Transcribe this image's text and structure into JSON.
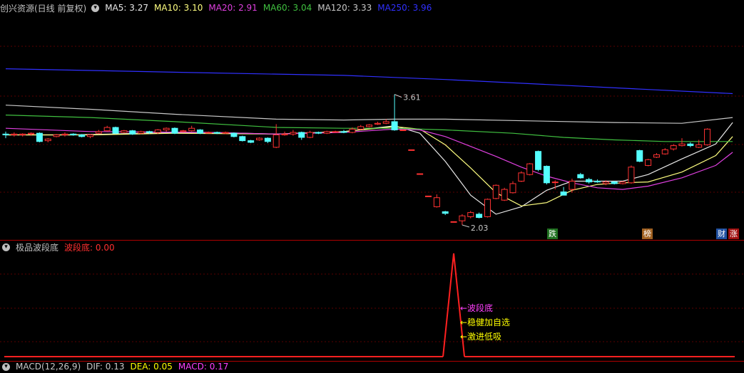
{
  "main_legend": {
    "title": "创兴资源(日线 前复权)",
    "items": [
      {
        "label": "MA5: 3.27",
        "color": "#e8e8e8"
      },
      {
        "label": "MA10: 3.10",
        "color": "#ffff80"
      },
      {
        "label": "MA20: 2.91",
        "color": "#e040e0"
      },
      {
        "label": "MA60: 3.04",
        "color": "#40c040"
      },
      {
        "label": "MA120: 3.33",
        "color": "#c8c8c8"
      },
      {
        "label": "MA250: 3.96",
        "color": "#3030ff"
      }
    ]
  },
  "annotations": {
    "high": "3.61",
    "low": "2.03"
  },
  "badges": [
    {
      "text": "跌",
      "bg": "#207020"
    },
    {
      "text": "榜",
      "bg": "#a06020"
    },
    {
      "text": "财",
      "bg": "#2050a0"
    },
    {
      "text": "涨",
      "bg": "#a01010"
    }
  ],
  "indicator_legend": {
    "title": "极品波段底",
    "items": [
      {
        "label": "波段底: 0.00",
        "color": "#ff3030"
      }
    ]
  },
  "signal_labels": [
    {
      "text": "←波段底",
      "color": "#ff40ff"
    },
    {
      "text": "←稳健加自选",
      "color": "#ffff00"
    },
    {
      "text": "←激进低吸",
      "color": "#ffff00"
    }
  ],
  "macd_legend": {
    "items": [
      {
        "label": "MACD(12,26,9)",
        "color": "#c8c8c8"
      },
      {
        "label": "DIF: 0.13",
        "color": "#c8c8c8"
      },
      {
        "label": "DEA: 0.05",
        "color": "#ffff00"
      },
      {
        "label": "MACD: 0.17",
        "color": "#ff40ff"
      }
    ]
  },
  "icons": {
    "collapse_icon": "chevron-down-icon"
  },
  "colors": {
    "up": "#ff3232",
    "down": "#54ffff",
    "frame": "#b00000"
  },
  "chart_data": {
    "type": "candlestick",
    "title": "创兴资源(日线 前复权)",
    "y_price_marks": {
      "high": 3.61,
      "low": 2.03
    },
    "candles": [
      {
        "o": 3.13,
        "c": 3.12,
        "h": 3.16,
        "l": 3.08
      },
      {
        "o": 3.12,
        "c": 3.13,
        "h": 3.15,
        "l": 3.1
      },
      {
        "o": 3.12,
        "c": 3.13,
        "h": 3.14,
        "l": 3.1
      },
      {
        "o": 3.13,
        "c": 3.14,
        "h": 3.15,
        "l": 3.11
      },
      {
        "o": 3.14,
        "c": 3.04,
        "h": 3.15,
        "l": 3.03
      },
      {
        "o": 3.05,
        "c": 3.07,
        "h": 3.08,
        "l": 3.03
      },
      {
        "o": 3.1,
        "c": 3.12,
        "h": 3.13,
        "l": 3.09
      },
      {
        "o": 3.12,
        "c": 3.13,
        "h": 3.15,
        "l": 3.1
      },
      {
        "o": 3.13,
        "c": 3.12,
        "h": 3.14,
        "l": 3.11
      },
      {
        "o": 3.12,
        "c": 3.1,
        "h": 3.13,
        "l": 3.09
      },
      {
        "o": 3.1,
        "c": 3.12,
        "h": 3.13,
        "l": 3.08
      },
      {
        "o": 3.14,
        "c": 3.16,
        "h": 3.18,
        "l": 3.13
      },
      {
        "o": 3.17,
        "c": 3.21,
        "h": 3.23,
        "l": 3.16
      },
      {
        "o": 3.21,
        "c": 3.14,
        "h": 3.22,
        "l": 3.13
      },
      {
        "o": 3.15,
        "c": 3.17,
        "h": 3.18,
        "l": 3.14
      },
      {
        "o": 3.17,
        "c": 3.13,
        "h": 3.18,
        "l": 3.12
      },
      {
        "o": 3.14,
        "c": 3.16,
        "h": 3.17,
        "l": 3.13
      },
      {
        "o": 3.16,
        "c": 3.15,
        "h": 3.17,
        "l": 3.13
      },
      {
        "o": 3.15,
        "c": 3.18,
        "h": 3.19,
        "l": 3.13
      },
      {
        "o": 3.18,
        "c": 3.2,
        "h": 3.21,
        "l": 3.16
      },
      {
        "o": 3.2,
        "c": 3.14,
        "h": 3.21,
        "l": 3.13
      },
      {
        "o": 3.16,
        "c": 3.17,
        "h": 3.18,
        "l": 3.15
      },
      {
        "o": 3.17,
        "c": 3.2,
        "h": 3.23,
        "l": 3.16
      },
      {
        "o": 3.18,
        "c": 3.14,
        "h": 3.19,
        "l": 3.13
      },
      {
        "o": 3.15,
        "c": 3.15,
        "h": 3.16,
        "l": 3.14
      },
      {
        "o": 3.15,
        "c": 3.14,
        "h": 3.16,
        "l": 3.13
      },
      {
        "o": 3.14,
        "c": 3.15,
        "h": 3.16,
        "l": 3.13
      },
      {
        "o": 3.14,
        "c": 3.1,
        "h": 3.15,
        "l": 3.09
      },
      {
        "o": 3.1,
        "c": 3.05,
        "h": 3.11,
        "l": 3.04
      },
      {
        "o": 3.05,
        "c": 3.03,
        "h": 3.06,
        "l": 3.02
      },
      {
        "o": 3.06,
        "c": 3.08,
        "h": 3.09,
        "l": 3.05
      },
      {
        "o": 3.08,
        "c": 3.04,
        "h": 3.09,
        "l": 3.02
      },
      {
        "o": 2.97,
        "c": 3.12,
        "h": 3.25,
        "l": 2.96
      },
      {
        "o": 3.12,
        "c": 3.13,
        "h": 3.16,
        "l": 3.11
      },
      {
        "o": 3.13,
        "c": 3.15,
        "h": 3.18,
        "l": 3.11
      },
      {
        "o": 3.15,
        "c": 3.09,
        "h": 3.16,
        "l": 3.06
      },
      {
        "o": 3.09,
        "c": 3.15,
        "h": 3.17,
        "l": 3.08
      },
      {
        "o": 3.15,
        "c": 3.14,
        "h": 3.16,
        "l": 3.13
      },
      {
        "o": 3.14,
        "c": 3.16,
        "h": 3.17,
        "l": 3.13
      },
      {
        "o": 3.16,
        "c": 3.16,
        "h": 3.17,
        "l": 3.15
      },
      {
        "o": 3.16,
        "c": 3.15,
        "h": 3.18,
        "l": 3.14
      },
      {
        "o": 3.15,
        "c": 3.19,
        "h": 3.21,
        "l": 3.14
      },
      {
        "o": 3.19,
        "c": 3.22,
        "h": 3.24,
        "l": 3.18
      },
      {
        "o": 3.22,
        "c": 3.24,
        "h": 3.25,
        "l": 3.21
      },
      {
        "o": 3.25,
        "c": 3.26,
        "h": 3.28,
        "l": 3.24
      },
      {
        "o": 3.26,
        "c": 3.28,
        "h": 3.31,
        "l": 3.25
      },
      {
        "o": 3.28,
        "c": 3.18,
        "h": 3.61,
        "l": 3.17
      },
      {
        "o": 3.18,
        "c": 3.18,
        "h": 3.18,
        "l": 3.18
      },
      {
        "o": 2.94,
        "c": 2.94,
        "h": 2.94,
        "l": 2.94
      },
      {
        "o": 2.65,
        "c": 2.65,
        "h": 2.65,
        "l": 2.65
      },
      {
        "o": 2.38,
        "c": 2.38,
        "h": 2.38,
        "l": 2.38
      },
      {
        "o": 2.25,
        "c": 2.36,
        "h": 2.4,
        "l": 2.24
      },
      {
        "o": 2.19,
        "c": 2.17,
        "h": 2.2,
        "l": 2.15
      },
      {
        "o": 2.07,
        "c": 2.07,
        "h": 2.07,
        "l": 2.07
      },
      {
        "o": 2.08,
        "c": 2.14,
        "h": 2.16,
        "l": 2.03
      },
      {
        "o": 2.13,
        "c": 2.18,
        "h": 2.2,
        "l": 2.11
      },
      {
        "o": 2.16,
        "c": 2.12,
        "h": 2.18,
        "l": 2.11
      },
      {
        "o": 2.13,
        "c": 2.34,
        "h": 2.35,
        "l": 2.12
      },
      {
        "o": 2.35,
        "c": 2.51,
        "h": 2.52,
        "l": 2.34
      },
      {
        "o": 2.33,
        "c": 2.46,
        "h": 2.48,
        "l": 2.32
      },
      {
        "o": 2.42,
        "c": 2.53,
        "h": 2.56,
        "l": 2.41
      },
      {
        "o": 2.56,
        "c": 2.66,
        "h": 2.68,
        "l": 2.55
      },
      {
        "o": 2.64,
        "c": 2.77,
        "h": 2.78,
        "l": 2.63
      },
      {
        "o": 2.92,
        "c": 2.7,
        "h": 2.93,
        "l": 2.68
      },
      {
        "o": 2.74,
        "c": 2.54,
        "h": 2.75,
        "l": 2.52
      },
      {
        "o": 2.55,
        "c": 2.55,
        "h": 2.57,
        "l": 2.46
      },
      {
        "o": 2.43,
        "c": 2.39,
        "h": 2.49,
        "l": 2.39
      },
      {
        "o": 2.46,
        "c": 2.56,
        "h": 2.59,
        "l": 2.42
      },
      {
        "o": 2.64,
        "c": 2.6,
        "h": 2.66,
        "l": 2.59
      },
      {
        "o": 2.58,
        "c": 2.55,
        "h": 2.6,
        "l": 2.53
      },
      {
        "o": 2.56,
        "c": 2.55,
        "h": 2.58,
        "l": 2.54
      },
      {
        "o": 2.53,
        "c": 2.55,
        "h": 2.57,
        "l": 2.51
      },
      {
        "o": 2.55,
        "c": 2.53,
        "h": 2.56,
        "l": 2.52
      },
      {
        "o": 2.53,
        "c": 2.55,
        "h": 2.56,
        "l": 2.52
      },
      {
        "o": 2.54,
        "c": 2.73,
        "h": 2.75,
        "l": 2.53
      },
      {
        "o": 2.93,
        "c": 2.8,
        "h": 2.94,
        "l": 2.79
      },
      {
        "o": 2.75,
        "c": 2.82,
        "h": 2.83,
        "l": 2.74
      },
      {
        "o": 2.85,
        "c": 2.88,
        "h": 2.9,
        "l": 2.84
      },
      {
        "o": 2.89,
        "c": 2.94,
        "h": 2.96,
        "l": 2.88
      },
      {
        "o": 2.95,
        "c": 2.99,
        "h": 3.01,
        "l": 2.93
      },
      {
        "o": 2.99,
        "c": 3.01,
        "h": 3.08,
        "l": 2.98
      },
      {
        "o": 3.01,
        "c": 2.99,
        "h": 3.03,
        "l": 2.97
      },
      {
        "o": 2.97,
        "c": 3.0,
        "h": 3.06,
        "l": 2.96
      },
      {
        "o": 3.0,
        "c": 3.19,
        "h": 3.2,
        "l": 2.99
      }
    ],
    "ma_series": [
      {
        "name": "MA5",
        "values": [
          [
            0,
            3.12
          ],
          [
            8,
            3.12
          ],
          [
            16,
            3.14
          ],
          [
            24,
            3.15
          ],
          [
            32,
            3.13
          ],
          [
            40,
            3.16
          ],
          [
            46,
            3.23
          ],
          [
            49,
            3.14
          ],
          [
            52,
            2.8
          ],
          [
            55,
            2.39
          ],
          [
            58,
            2.16
          ],
          [
            61,
            2.25
          ],
          [
            64,
            2.45
          ],
          [
            67,
            2.56
          ],
          [
            70,
            2.56
          ],
          [
            73,
            2.56
          ],
          [
            76,
            2.64
          ],
          [
            80,
            2.83
          ],
          [
            84,
            3.01
          ],
          [
            86,
            3.27
          ]
        ]
      },
      {
        "name": "MA10",
        "values": [
          [
            0,
            3.12
          ],
          [
            10,
            3.12
          ],
          [
            20,
            3.14
          ],
          [
            32,
            3.13
          ],
          [
            40,
            3.16
          ],
          [
            46,
            3.22
          ],
          [
            49,
            3.19
          ],
          [
            52,
            3.0
          ],
          [
            55,
            2.72
          ],
          [
            58,
            2.42
          ],
          [
            61,
            2.26
          ],
          [
            64,
            2.3
          ],
          [
            67,
            2.45
          ],
          [
            70,
            2.52
          ],
          [
            73,
            2.54
          ],
          [
            76,
            2.55
          ],
          [
            80,
            2.67
          ],
          [
            84,
            2.87
          ],
          [
            86,
            3.1
          ]
        ]
      },
      {
        "name": "MA20",
        "values": [
          [
            0,
            3.2
          ],
          [
            10,
            3.16
          ],
          [
            24,
            3.15
          ],
          [
            32,
            3.13
          ],
          [
            40,
            3.15
          ],
          [
            46,
            3.19
          ],
          [
            49,
            3.18
          ],
          [
            52,
            3.1
          ],
          [
            55,
            2.98
          ],
          [
            58,
            2.86
          ],
          [
            61,
            2.73
          ],
          [
            64,
            2.62
          ],
          [
            67,
            2.54
          ],
          [
            70,
            2.48
          ],
          [
            73,
            2.46
          ],
          [
            76,
            2.5
          ],
          [
            80,
            2.6
          ],
          [
            84,
            2.75
          ],
          [
            86,
            2.91
          ]
        ]
      },
      {
        "name": "MA60",
        "values": [
          [
            0,
            3.36
          ],
          [
            10,
            3.33
          ],
          [
            20,
            3.28
          ],
          [
            32,
            3.21
          ],
          [
            40,
            3.2
          ],
          [
            46,
            3.2
          ],
          [
            52,
            3.18
          ],
          [
            60,
            3.14
          ],
          [
            66,
            3.09
          ],
          [
            72,
            3.06
          ],
          [
            78,
            3.04
          ],
          [
            86,
            3.04
          ]
        ]
      },
      {
        "name": "MA120",
        "values": [
          [
            0,
            3.48
          ],
          [
            10,
            3.43
          ],
          [
            20,
            3.37
          ],
          [
            32,
            3.31
          ],
          [
            40,
            3.3
          ],
          [
            46,
            3.31
          ],
          [
            52,
            3.31
          ],
          [
            62,
            3.29
          ],
          [
            72,
            3.27
          ],
          [
            80,
            3.26
          ],
          [
            86,
            3.33
          ]
        ]
      },
      {
        "name": "MA250",
        "values": [
          [
            0,
            3.92
          ],
          [
            10,
            3.9
          ],
          [
            24,
            3.87
          ],
          [
            40,
            3.84
          ],
          [
            52,
            3.79
          ],
          [
            64,
            3.73
          ],
          [
            76,
            3.67
          ],
          [
            86,
            3.62
          ]
        ]
      }
    ],
    "indicator": {
      "name": "波段底",
      "baseline": 0,
      "spike_index": 53,
      "spike_value": 1
    }
  }
}
